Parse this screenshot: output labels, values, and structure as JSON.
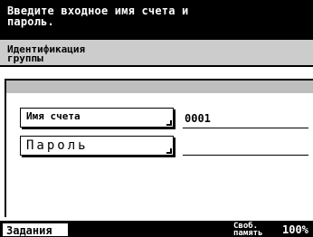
{
  "header": {
    "message": "Введите входное имя счета и\nпароль."
  },
  "group": {
    "title": "Идентификация\nгруппы"
  },
  "fields": {
    "account": {
      "label": "Имя счета",
      "value": "0001"
    },
    "password": {
      "label": "Пароль",
      "value": ""
    }
  },
  "footer": {
    "jobs_label": "Задания",
    "memory_label": "Своб.\nпамять",
    "memory_value": "100%"
  }
}
